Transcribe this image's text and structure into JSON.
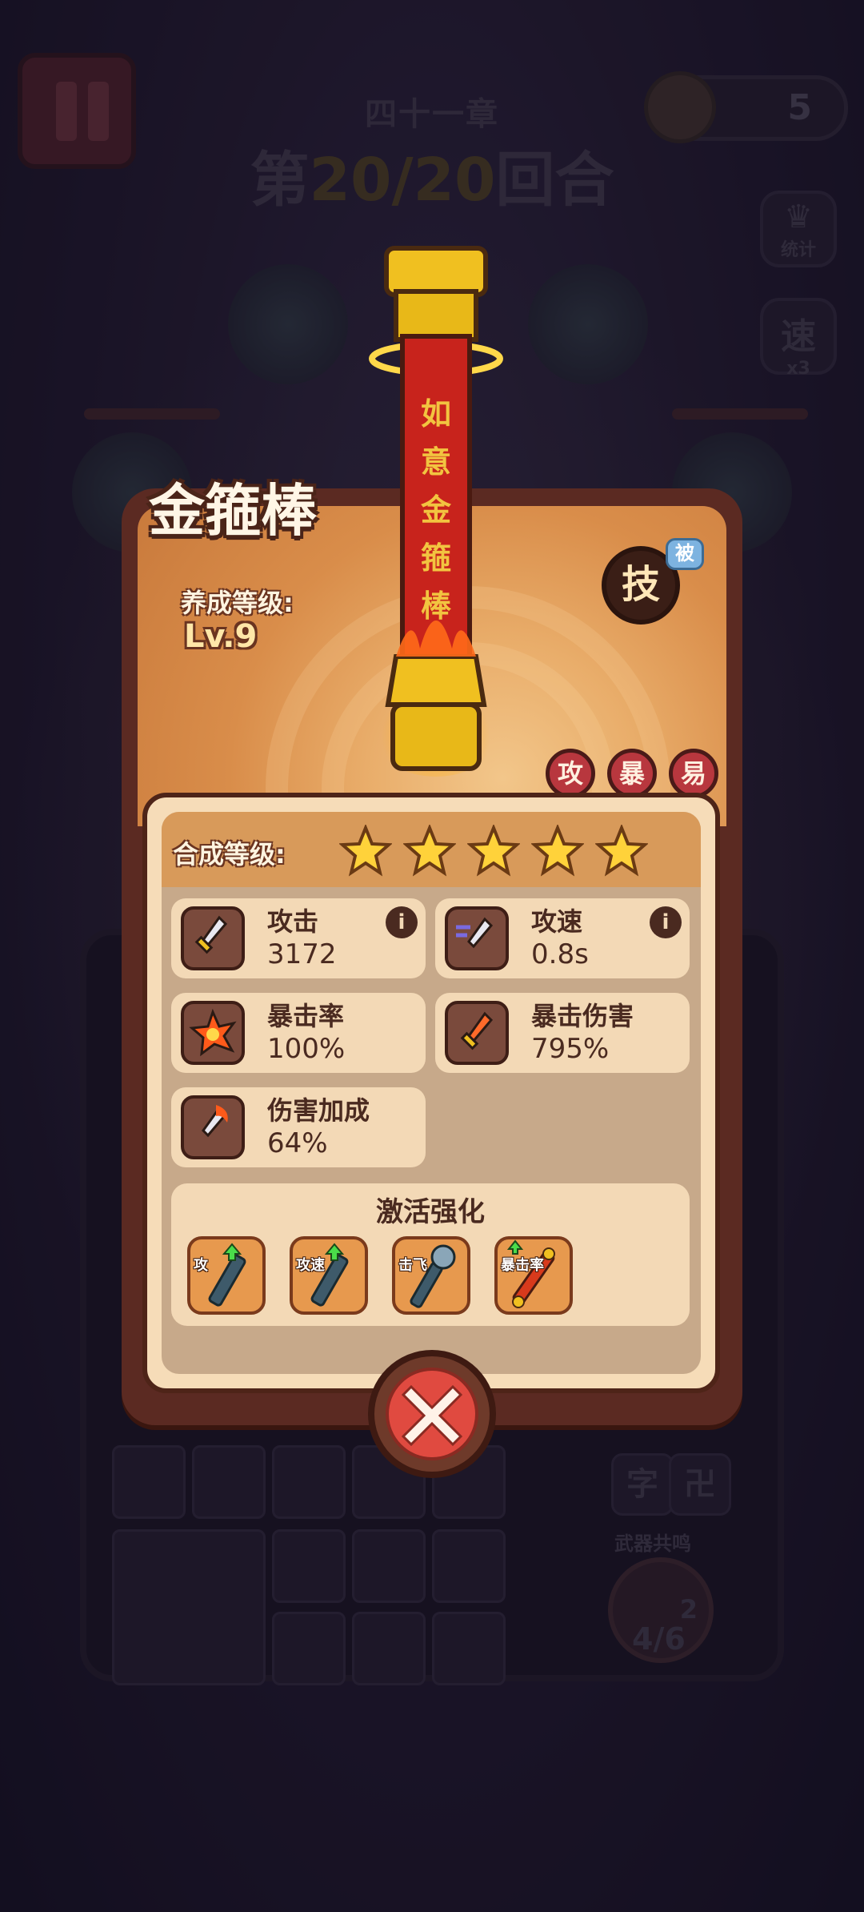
{
  "hud": {
    "chapter": "四十一章",
    "round_prefix": "第",
    "round": "20/20",
    "round_suffix": "回合",
    "coins": "5",
    "stats_button": "统计",
    "speed_button": "速",
    "speed_multiplier": "x3"
  },
  "board": {
    "resonance_label": "武器共鸣",
    "resonance_level": "2",
    "resonance_count": "4/6",
    "glyph_1": "字",
    "glyph_2": "卍"
  },
  "weapon": {
    "name": "金箍棒",
    "level_label": "养成等级:",
    "level_value": "Lv.9",
    "skill_label": "技",
    "passive_badge": "被",
    "staff_inscription": [
      "如",
      "意",
      "金",
      "箍",
      "棒"
    ],
    "tags": [
      "攻",
      "暴",
      "易"
    ],
    "colors": {
      "accent_red": "#b8373e",
      "gold": "#f0c020",
      "panel": "#f6dcb8"
    }
  },
  "stars": {
    "label": "合成等级:",
    "filled": 5,
    "total": 5
  },
  "stats": {
    "attack": {
      "name": "攻击",
      "value": "3172",
      "icon": "sword-icon"
    },
    "attack_speed": {
      "name": "攻速",
      "value": "0.8s",
      "icon": "speed-sword-icon"
    },
    "crit_rate": {
      "name": "暴击率",
      "value": "100%",
      "icon": "burst-icon"
    },
    "crit_damage": {
      "name": "暴击伤害",
      "value": "795%",
      "icon": "fire-sword-icon"
    },
    "damage_bonus": {
      "name": "伤害加成",
      "value": "64%",
      "icon": "flame-sword-icon"
    }
  },
  "enhance": {
    "title": "激活强化",
    "items": [
      {
        "label": "攻",
        "icon": "staff-up-icon"
      },
      {
        "label": "攻速",
        "icon": "staff-up-icon"
      },
      {
        "label": "击飞",
        "icon": "mace-icon"
      },
      {
        "label": "暴击率",
        "icon": "golden-staff-icon"
      }
    ]
  }
}
